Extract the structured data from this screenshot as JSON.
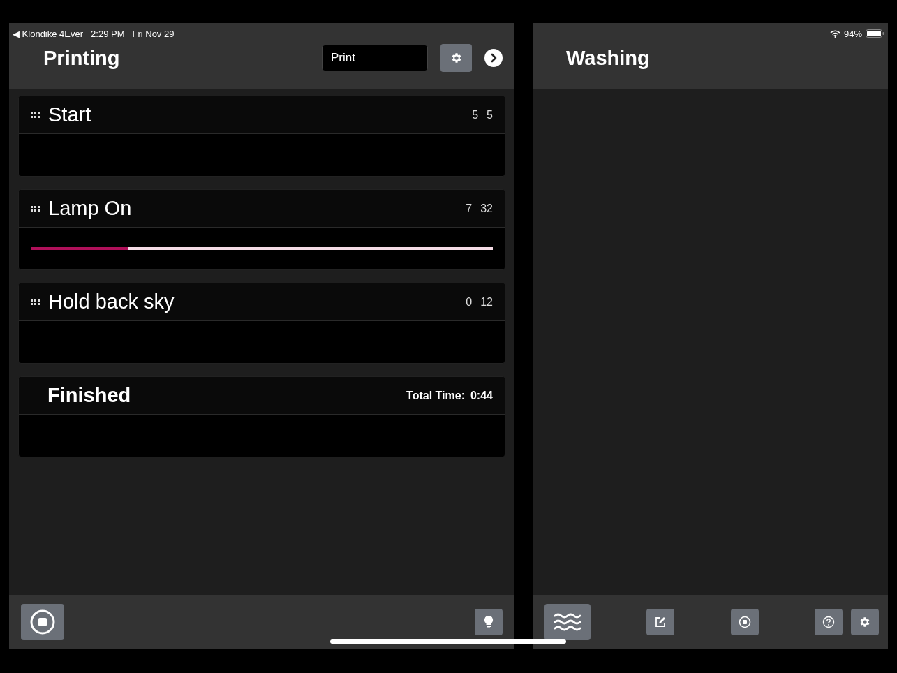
{
  "status_bar": {
    "back_label": "◀ Klondike 4Ever",
    "time": "2:29 PM",
    "date": "Fri Nov 29",
    "battery": "94%"
  },
  "left_panel": {
    "title": "Printing",
    "input": {
      "value": "Print"
    },
    "steps": [
      {
        "kind": "step",
        "name": "Start",
        "count_1": "5",
        "count_2": "5"
      },
      {
        "kind": "step",
        "name": "Lamp On",
        "count_1": "7",
        "count_2": "32",
        "level": 0.21
      },
      {
        "kind": "step",
        "name": "Hold back sky",
        "count_1": "0",
        "count_2": "12"
      },
      {
        "kind": "finished",
        "name": "Finished",
        "total_label": "Total Time:",
        "total_value": "0:44"
      }
    ]
  },
  "right_panel": {
    "title": "Washing"
  }
}
